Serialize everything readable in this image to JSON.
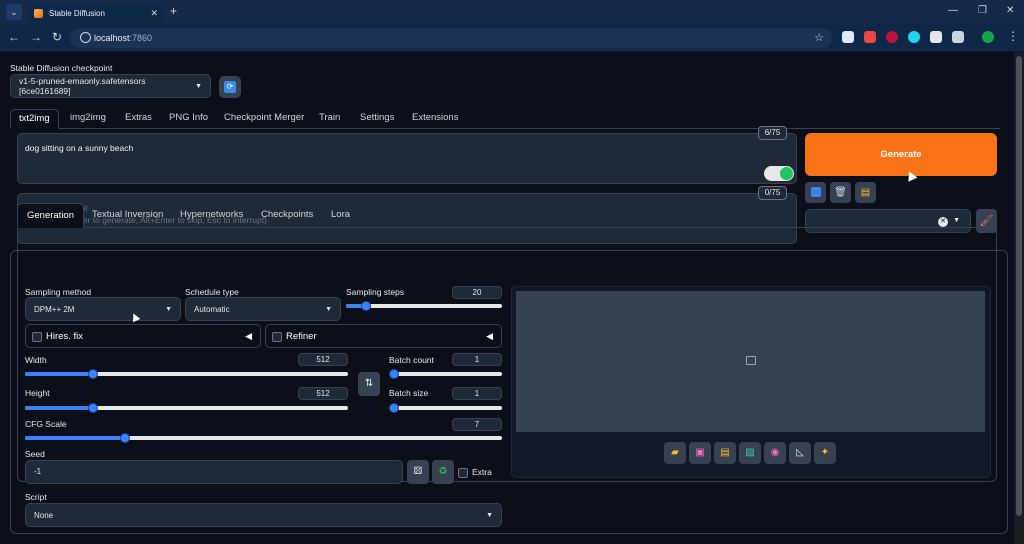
{
  "browser": {
    "tab_title": "Stable Diffusion",
    "url_host": "localhost",
    "url_port": ":7860"
  },
  "checkpoint": {
    "label": "Stable Diffusion checkpoint",
    "value": "v1-5-pruned-emaonly.safetensors [6ce0161689]"
  },
  "main_tabs": [
    "txt2img",
    "img2img",
    "Extras",
    "PNG Info",
    "Checkpoint Merger",
    "Train",
    "Settings",
    "Extensions"
  ],
  "prompt": {
    "value": "dog sitting on a sunny beach",
    "token_count": "6/75"
  },
  "negative_prompt": {
    "placeholder": "Negative prompt\n(Press Ctrl+Enter to generate, Alt+Enter to skip, Esc to interrupt)",
    "token_count": "0/75"
  },
  "generate_label": "Generate",
  "sub_tabs": [
    "Generation",
    "Textual Inversion",
    "Hypernetworks",
    "Checkpoints",
    "Lora"
  ],
  "generation": {
    "sampling_method_label": "Sampling method",
    "sampling_method_value": "DPM++ 2M",
    "schedule_type_label": "Schedule type",
    "schedule_type_value": "Automatic",
    "sampling_steps_label": "Sampling steps",
    "sampling_steps_value": "20",
    "sampling_steps_fraction": 0.13,
    "hires_fix_label": "Hires. fix",
    "refiner_label": "Refiner",
    "width_label": "Width",
    "width_value": "512",
    "width_fraction": 0.21,
    "height_label": "Height",
    "height_value": "512",
    "height_fraction": 0.21,
    "batch_count_label": "Batch count",
    "batch_count_value": "1",
    "batch_count_fraction": 0.0,
    "batch_size_label": "Batch size",
    "batch_size_value": "1",
    "batch_size_fraction": 0.0,
    "cfg_label": "CFG Scale",
    "cfg_value": "7",
    "cfg_fraction": 0.21,
    "seed_label": "Seed",
    "seed_value": "-1",
    "extra_label": "Extra",
    "script_label": "Script",
    "script_value": "None"
  },
  "icons": {
    "accent_generate": "#f97316",
    "slider_accent": "#3b82f6"
  }
}
